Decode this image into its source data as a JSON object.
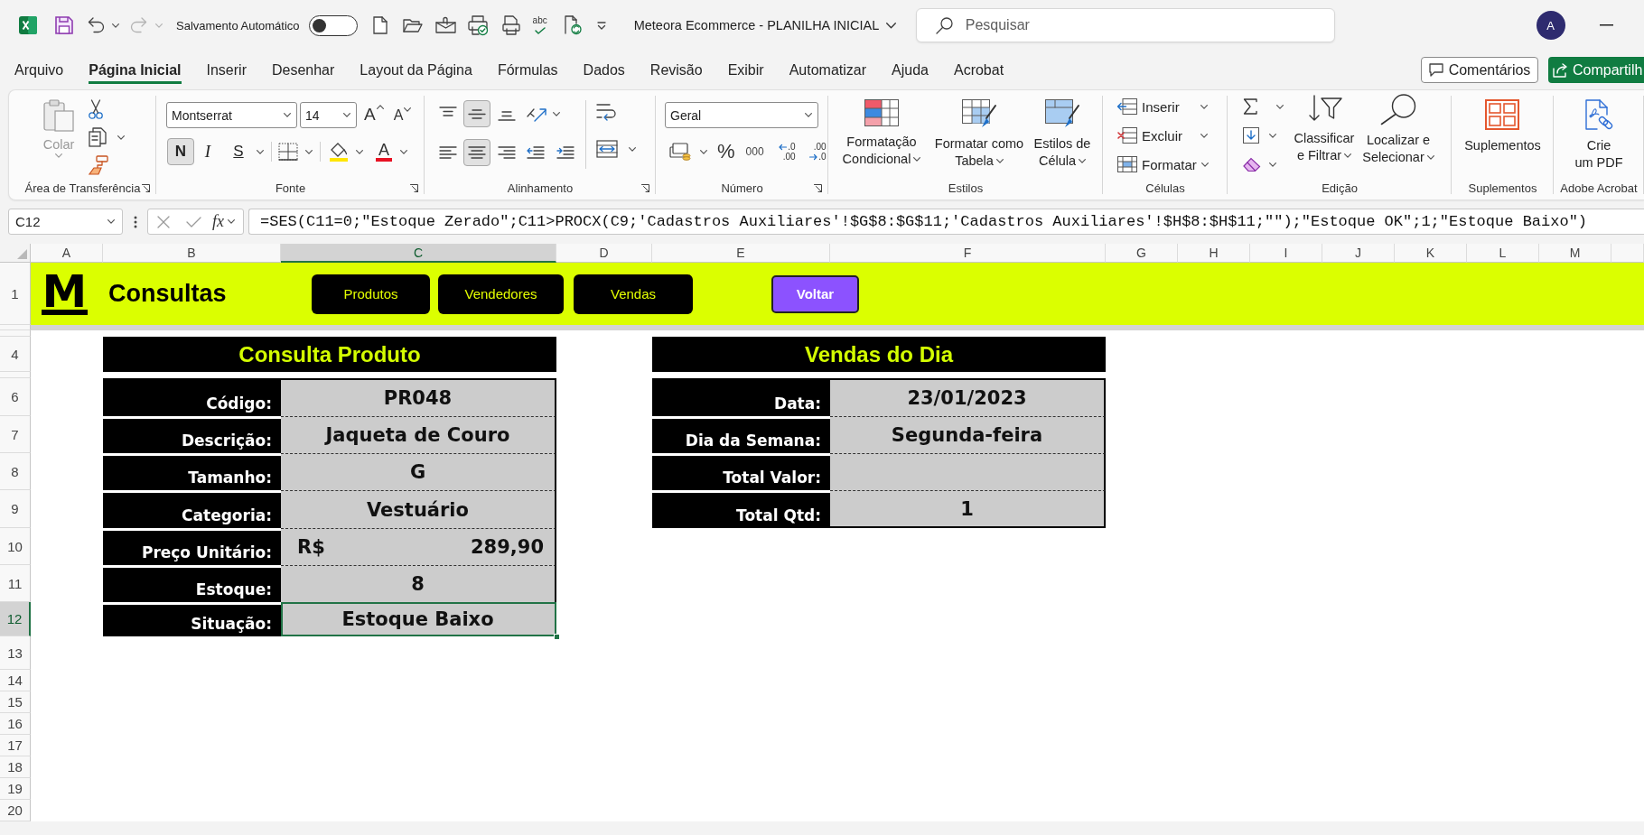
{
  "title_bar": {
    "autosave_label": "Salvamento Automático",
    "autosave_on": false,
    "redo_disabled": true,
    "spellcheck_glyph": "abc",
    "document_title": "Meteora Ecommerce - PLANILHA INICIAL",
    "search": {
      "placeholder": "Pesquisar"
    },
    "avatar": "A"
  },
  "ribbon": {
    "tabs": [
      {
        "label": "Arquivo",
        "selected": false
      },
      {
        "label": "Página Inicial",
        "selected": true
      },
      {
        "label": "Inserir",
        "selected": false
      },
      {
        "label": "Desenhar",
        "selected": false
      },
      {
        "label": "Layout da Página",
        "selected": false
      },
      {
        "label": "Fórmulas",
        "selected": false
      },
      {
        "label": "Dados",
        "selected": false
      },
      {
        "label": "Revisão",
        "selected": false
      },
      {
        "label": "Exibir",
        "selected": false
      },
      {
        "label": "Automatizar",
        "selected": false
      },
      {
        "label": "Ajuda",
        "selected": false
      },
      {
        "label": "Acrobat",
        "selected": false
      }
    ],
    "comments_button": "Comentários",
    "share_button": "Compartilh",
    "clipboard": {
      "title": "Área de Transferência",
      "paste": {
        "label": "Colar",
        "disabled": true
      }
    },
    "font": {
      "title": "Fonte",
      "family": "Montserrat",
      "size": "14",
      "grow_glyph": "A",
      "shrink_glyph": "A",
      "styles": [
        {
          "kind": "bold",
          "glyph": "N",
          "selected": true
        },
        {
          "kind": "italic",
          "glyph": "I",
          "selected": false
        },
        {
          "kind": "underline",
          "glyph": "S",
          "selected": false
        }
      ],
      "font_color_glyph": "A"
    },
    "alignment": {
      "title": "Alinhamento",
      "vertical": [
        {
          "kind": "top",
          "selected": false
        },
        {
          "kind": "middle",
          "selected": true
        },
        {
          "kind": "bottom",
          "selected": false
        }
      ],
      "horizontal": [
        {
          "kind": "left",
          "selected": false
        },
        {
          "kind": "center",
          "selected": true
        },
        {
          "kind": "right",
          "selected": false
        }
      ]
    },
    "number": {
      "title": "Número",
      "format": "Geral",
      "percent_glyph": "%",
      "thousands_glyph": "000",
      "decimal_buttons": [
        {
          "kind": "increase",
          "top": ".0",
          "bottom": ".00"
        },
        {
          "kind": "decrease",
          "top": ".00",
          "bottom": ".0"
        }
      ]
    },
    "styles": {
      "title": "Estilos",
      "buttons": [
        {
          "kind": "conditional",
          "lines": [
            "Formatação",
            "Condicional"
          ]
        },
        {
          "kind": "table",
          "lines": [
            "Formatar como",
            "Tabela"
          ]
        },
        {
          "kind": "cellstyles",
          "lines": [
            "Estilos de",
            "Célula"
          ]
        }
      ]
    },
    "cells": {
      "title": "Células",
      "buttons": [
        {
          "kind": "insert",
          "label": "Inserir"
        },
        {
          "kind": "delete",
          "label": "Excluir"
        },
        {
          "kind": "format",
          "label": "Formatar"
        }
      ]
    },
    "editing": {
      "title": "Edição",
      "buttons": [
        {
          "kind": "sort",
          "lines": [
            "Classificar",
            "e Filtrar"
          ]
        },
        {
          "kind": "find",
          "lines": [
            "Localizar e",
            "Selecionar"
          ]
        }
      ]
    },
    "addins": {
      "title": "Suplementos",
      "label": "Suplementos"
    },
    "acrobat": {
      "title": "Adobe Acrobat",
      "lines": [
        "Crie",
        "um PDF"
      ]
    }
  },
  "formula_bar": {
    "name_box": "C12",
    "function_glyph": "fx",
    "formula": "=SES(C11=0;\"Estoque Zerado\";C11>PROCX(C9;'Cadastros Auxiliares'!$G$8:$G$11;'Cadastros Auxiliares'!$H$8:$H$11;\"\");\"Estoque OK\";1;\"Estoque Baixo\")"
  },
  "sheet": {
    "columns": [
      {
        "label": "A",
        "selected": false
      },
      {
        "label": "B",
        "selected": false
      },
      {
        "label": "C",
        "selected": true
      },
      {
        "label": "D",
        "selected": false
      },
      {
        "label": "E",
        "selected": false
      },
      {
        "label": "F",
        "selected": false
      },
      {
        "label": "G",
        "selected": false
      },
      {
        "label": "H",
        "selected": false
      },
      {
        "label": "I",
        "selected": false
      },
      {
        "label": "J",
        "selected": false
      },
      {
        "label": "K",
        "selected": false
      },
      {
        "label": "L",
        "selected": false
      },
      {
        "label": "M",
        "selected": false
      }
    ],
    "rows": [
      {
        "label": "1",
        "selected": false
      },
      {
        "label": "4",
        "selected": false
      },
      {
        "label": "6",
        "selected": false
      },
      {
        "label": "7",
        "selected": false
      },
      {
        "label": "8",
        "selected": false
      },
      {
        "label": "9",
        "selected": false
      },
      {
        "label": "10",
        "selected": false
      },
      {
        "label": "11",
        "selected": false
      },
      {
        "label": "12",
        "selected": true
      },
      {
        "label": "13",
        "selected": false
      },
      {
        "label": "14",
        "selected": false
      },
      {
        "label": "15",
        "selected": false
      },
      {
        "label": "16",
        "selected": false
      },
      {
        "label": "17",
        "selected": false
      },
      {
        "label": "18",
        "selected": false
      },
      {
        "label": "19",
        "selected": false
      },
      {
        "label": "20",
        "selected": false
      }
    ],
    "banner": {
      "logo": "M",
      "title": "Consultas",
      "buttons": [
        {
          "kind": "nav",
          "label": "Produtos"
        },
        {
          "kind": "nav",
          "label": "Vendedores"
        },
        {
          "kind": "nav",
          "label": "Vendas"
        },
        {
          "kind": "back",
          "label": "Voltar"
        }
      ]
    },
    "panels": [
      {
        "title": "Consulta Produto",
        "fields": [
          {
            "label": "Código:",
            "value": "PR048",
            "selected": false
          },
          {
            "label": "Descrição:",
            "value": "Jaqueta de Couro",
            "selected": false
          },
          {
            "label": "Tamanho:",
            "value": "G",
            "selected": false
          },
          {
            "label": "Categoria:",
            "value": "Vestuário",
            "selected": false
          },
          {
            "label": "Preço Unitário:",
            "currency": "R$",
            "value": "289,90",
            "selected": false
          },
          {
            "label": "Estoque:",
            "value": "8",
            "selected": false
          },
          {
            "label": "Situação:",
            "value": "Estoque Baixo",
            "selected": true
          }
        ]
      },
      {
        "title": "Vendas do Dia",
        "fields": [
          {
            "label": "Data:",
            "value": "23/01/2023",
            "selected": false
          },
          {
            "label": "Dia da Semana:",
            "value": "Segunda-feira",
            "selected": false
          },
          {
            "label": "Total Valor:",
            "selected": false
          },
          {
            "label": "Total Qtd:",
            "value": "1",
            "selected": false
          }
        ]
      }
    ]
  }
}
